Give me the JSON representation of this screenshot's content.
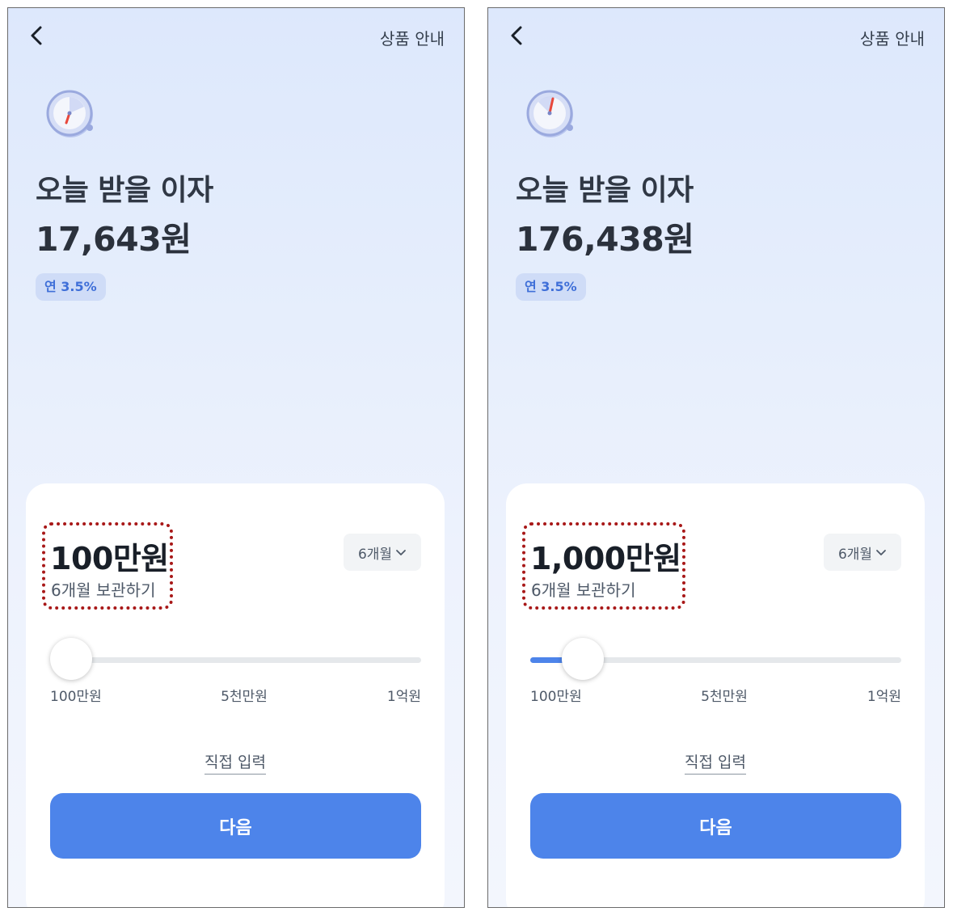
{
  "screens": [
    {
      "header": {
        "info_label": "상품 안내"
      },
      "title": "오늘 받을 이자",
      "interest": "17,643원",
      "rate_badge": "연 3.5%",
      "amount": "100만원",
      "amount_sub": "6개월 보관하기",
      "period_label": "6개월",
      "slider": {
        "min_label": "100만원",
        "mid_label": "5천만원",
        "max_label": "1억원",
        "value_fraction": 0.0
      },
      "direct_input_label": "직접 입력",
      "next_label": "다음"
    },
    {
      "header": {
        "info_label": "상품 안내"
      },
      "title": "오늘 받을 이자",
      "interest": "176,438원",
      "rate_badge": "연 3.5%",
      "amount": "1,000만원",
      "amount_sub": "6개월 보관하기",
      "period_label": "6개월",
      "slider": {
        "min_label": "100만원",
        "mid_label": "5천만원",
        "max_label": "1억원",
        "value_fraction": 0.09
      },
      "direct_input_label": "직접 입력",
      "next_label": "다음"
    }
  ],
  "icons": {
    "back": "chevron-left-icon",
    "timer": "timer-icon",
    "dropdown": "chevron-down-icon"
  },
  "colors": {
    "accent": "#4d84ea",
    "highlight_border": "#a81818",
    "badge_bg": "#cfdcf7",
    "badge_text": "#3f6fd8"
  }
}
